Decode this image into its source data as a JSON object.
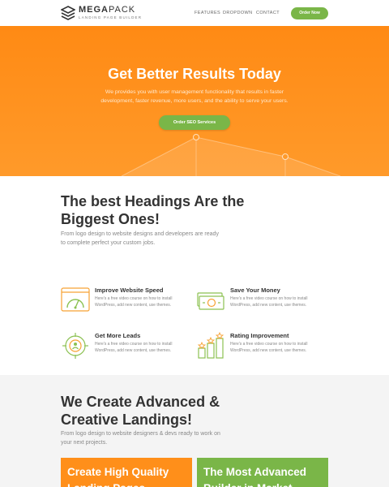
{
  "brand": {
    "title_bold": "MEGA",
    "title_light": "PACK",
    "subtitle": "LANDING PAGE BUILDER"
  },
  "nav": {
    "items": [
      {
        "label": "FEATURES"
      },
      {
        "label": "DROPDOWN"
      },
      {
        "label": "CONTACT"
      }
    ],
    "cta_label": "Order Now"
  },
  "hero": {
    "title": "Get Better Results Today",
    "text": "We provides you with user management functionality that results in faster development, faster revenue, more users, and the ability to serve your users.",
    "cta_label": "Order SEO Services"
  },
  "headings": {
    "title": "The best Headings Are the Biggest Ones!",
    "text": "From logo design to website designs and developers are ready to complete perfect your custom jobs."
  },
  "features": [
    {
      "title": "Improve Website Speed",
      "text": "Here's a free video course on how to install WordPress, add new content, use themes.",
      "icon": "speedometer-icon"
    },
    {
      "title": "Save Your Money",
      "text": "Here's a free video course on how to install WordPress, add new content, use themes.",
      "icon": "money-icon"
    },
    {
      "title": "Get More Leads",
      "text": "Here's a free video course on how to install WordPress, add new content, use themes.",
      "icon": "target-leads-icon"
    },
    {
      "title": "Rating Improvement",
      "text": "Here's a free video course on how to install WordPress, add new content, use themes.",
      "icon": "rating-bars-icon"
    }
  ],
  "landings": {
    "title": "We Create Advanced & Creative Landings!",
    "text": "From logo design to website designers & devs ready to work on your next projects."
  },
  "cards": [
    {
      "title": "Create High Quality Landing Pages",
      "color": "#ff8f1a"
    },
    {
      "title": "The Most Advanced Builder in Market",
      "color": "#7ab648"
    }
  ],
  "colors": {
    "accent_orange": "#ff8a14",
    "accent_green": "#7ab648",
    "icon_green": "#8cc152",
    "icon_orange": "#f7a234"
  }
}
